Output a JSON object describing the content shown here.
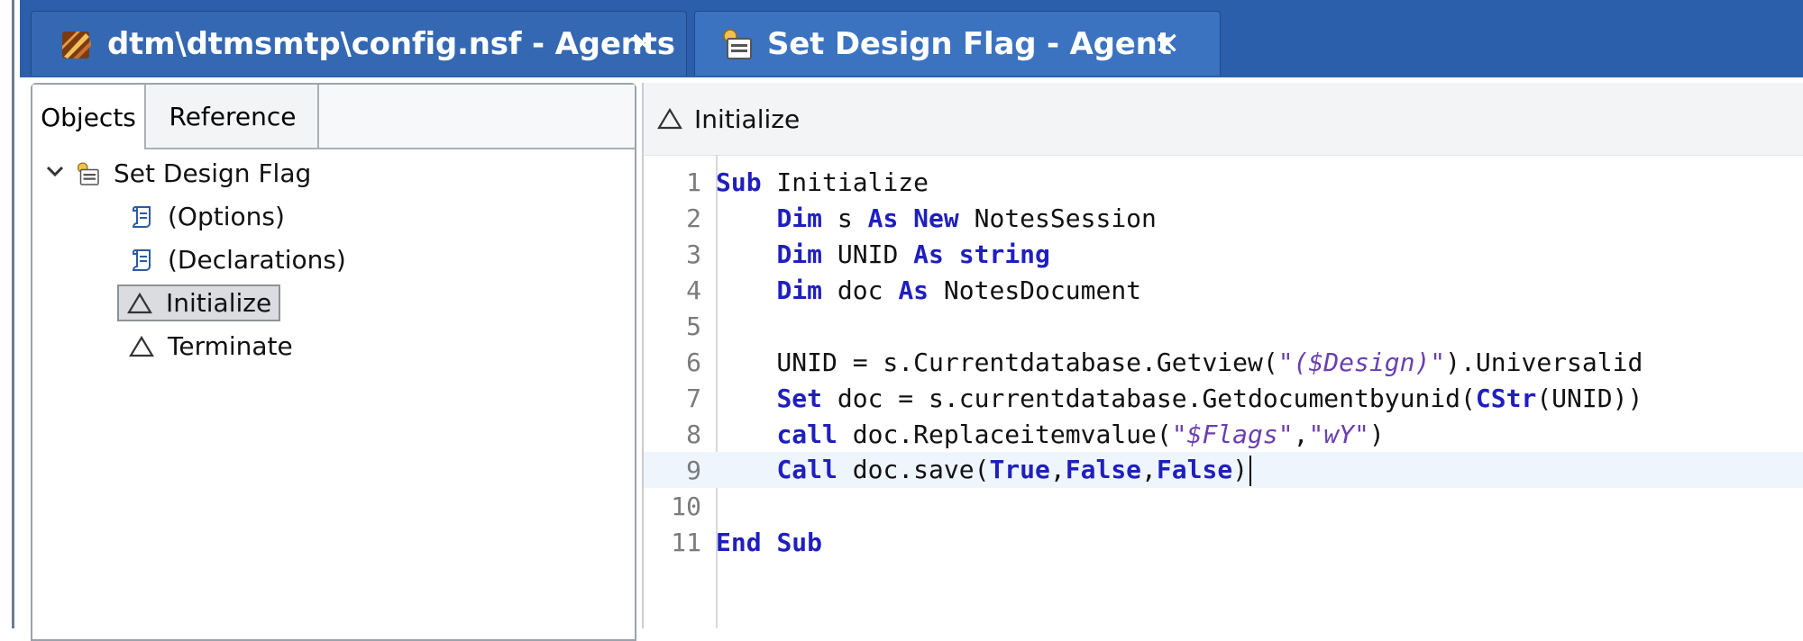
{
  "tabs": [
    {
      "label": "dtm\\dtmsmtp\\config.nsf - Agents",
      "close": "✕",
      "icon": "database-icon"
    },
    {
      "label": "Set Design Flag - Agent",
      "close": "✕",
      "icon": "agent-icon"
    }
  ],
  "left_panel": {
    "subtabs": [
      "Objects",
      "Reference"
    ],
    "tree": [
      {
        "label": "Set Design Flag",
        "icon": "agent-icon",
        "expanded": true
      },
      {
        "label": "(Options)",
        "icon": "script-icon"
      },
      {
        "label": "(Declarations)",
        "icon": "script-icon"
      },
      {
        "label": "Initialize",
        "icon": "triangle-icon",
        "selected": true
      },
      {
        "label": "Terminate",
        "icon": "triangle-icon"
      }
    ]
  },
  "editor": {
    "header_label": "Initialize",
    "lines": [
      {
        "n": "1",
        "text": "Sub Initialize"
      },
      {
        "n": "2",
        "text": "    Dim s As New NotesSession"
      },
      {
        "n": "3",
        "text": "    Dim UNID As string"
      },
      {
        "n": "4",
        "text": "    Dim doc As NotesDocument"
      },
      {
        "n": "5",
        "text": ""
      },
      {
        "n": "6",
        "text": "    UNID = s.Currentdatabase.Getview(\"($Design)\").Universalid"
      },
      {
        "n": "7",
        "text": "    Set doc = s.currentdatabase.Getdocumentbyunid(CStr(UNID))"
      },
      {
        "n": "8",
        "text": "    call doc.Replaceitemvalue(\"$Flags\",\"wY\")"
      },
      {
        "n": "9",
        "text": "    Call doc.save(True,False,False)"
      },
      {
        "n": "10",
        "text": ""
      },
      {
        "n": "11",
        "text": "End Sub"
      }
    ],
    "current_line": 9
  },
  "colors": {
    "tab_strip": "#2b5fab",
    "keyword": "#1f1fbf",
    "string": "#6b3fb0",
    "current_line": "#eef5fd"
  }
}
